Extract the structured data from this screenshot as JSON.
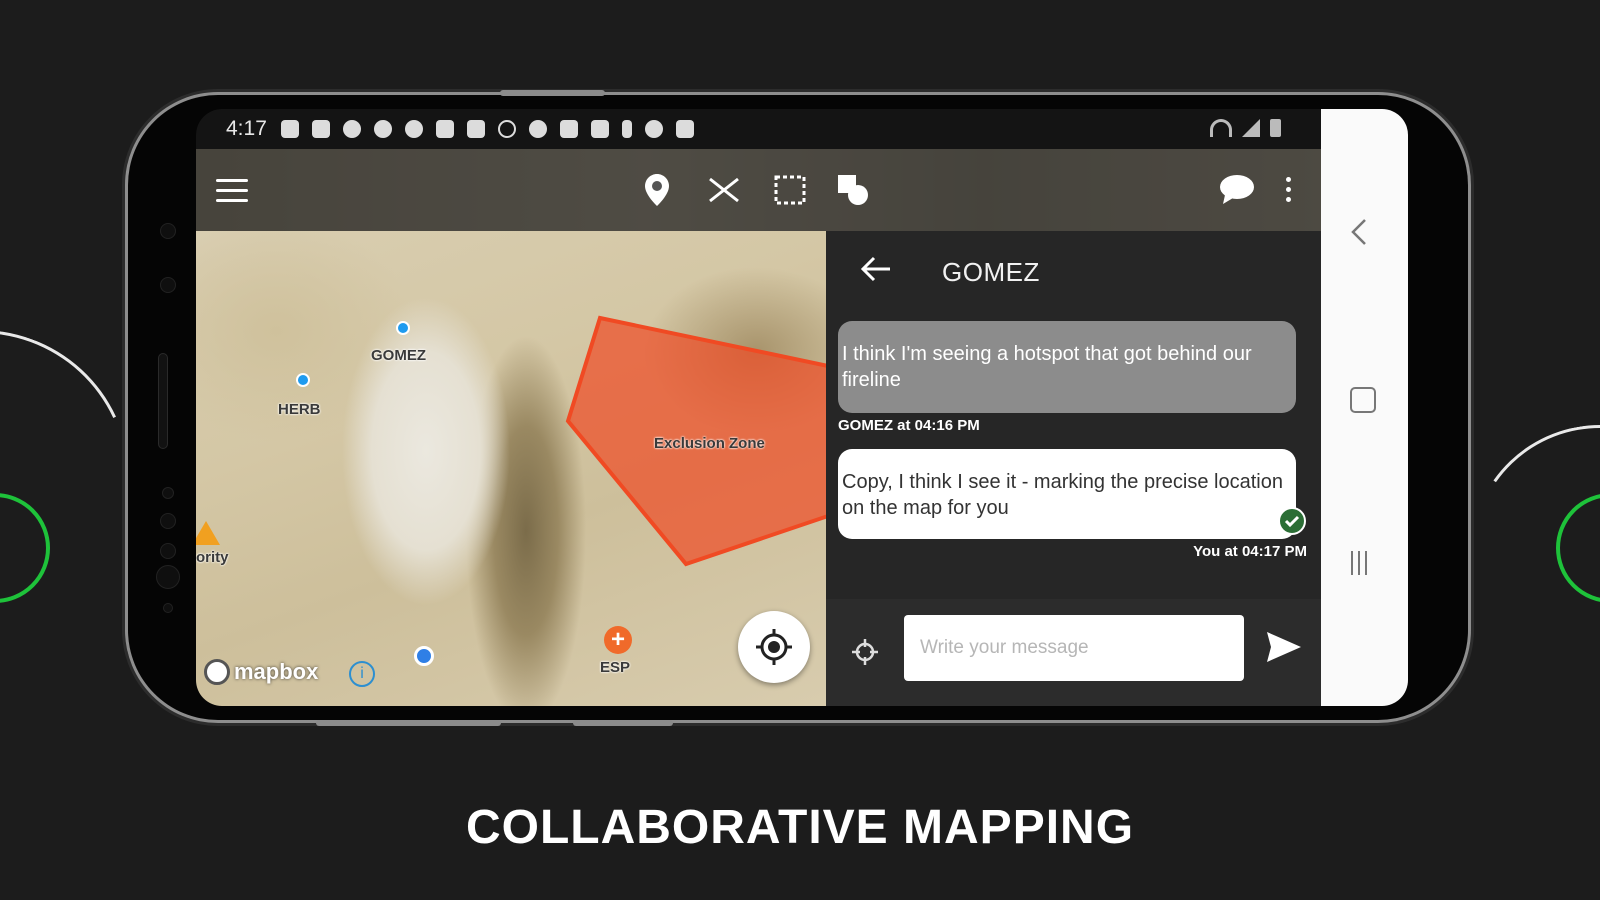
{
  "status_bar": {
    "time": "4:17"
  },
  "map": {
    "markers": [
      {
        "label": "GOMEZ"
      },
      {
        "label": "HERB"
      }
    ],
    "zone_label": "Exclusion Zone",
    "partial_label": "ority",
    "esp_label": "ESP",
    "attribution": "mapbox",
    "info_glyph": "i"
  },
  "chat": {
    "title": "GOMEZ",
    "messages": [
      {
        "text": "I think I'm seeing a hotspot that got behind our fireline",
        "meta": "GOMEZ at 04:16 PM"
      },
      {
        "text": "Copy, I think I see it - marking the precise location on the map for you",
        "meta": "You at 04:17 PM"
      }
    ],
    "input_placeholder": "Write your message"
  },
  "caption": "COLLABORATIVE MAPPING",
  "colors": {
    "accent_ring": "#1ec23a",
    "zone_fill": "#f04a23",
    "marker": "#1f9bef"
  }
}
